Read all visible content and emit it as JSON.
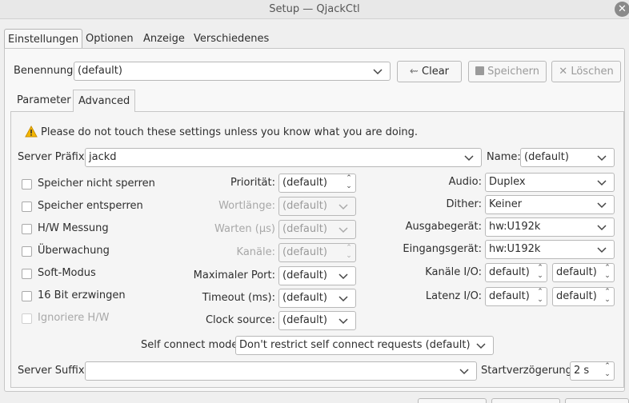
{
  "window": {
    "title": "Setup — QjackCtl"
  },
  "tabs": [
    "Einstellungen",
    "Optionen",
    "Anzeige",
    "Verschiedenes"
  ],
  "preset": {
    "label": "Benennung:",
    "value": "(default)",
    "clear": "Clear",
    "save": "Speichern",
    "delete": "Löschen"
  },
  "subtabs": [
    "Parameter",
    "Advanced"
  ],
  "warning": "Please do not touch these settings unless you know what you are doing.",
  "server": {
    "prefix_label": "Server Präfix:",
    "prefix_value": "jackd",
    "name_label": "Name:",
    "name_value": "(default)"
  },
  "checks": [
    "Speicher nicht sperren",
    "Speicher entsperren",
    "H/W Messung",
    "Überwachung",
    "Soft-Modus",
    "16 Bit erzwingen",
    "Ignoriere H/W"
  ],
  "mid": {
    "priority_label": "Priorität:",
    "priority_value": "(default)",
    "wordlength_label": "Wortlänge:",
    "wordlength_value": "(default)",
    "wait_label": "Warten (µs)",
    "wait_value": "(default)",
    "channels_label": "Kanäle:",
    "channels_value": "(default)",
    "maxport_label": "Maximaler Port:",
    "maxport_value": "(default)",
    "timeout_label": "Timeout (ms):",
    "timeout_value": "(default)",
    "clock_label": "Clock source:",
    "clock_value": "(default)"
  },
  "right": {
    "audio_label": "Audio:",
    "audio_value": "Duplex",
    "dither_label": "Dither:",
    "dither_value": "Keiner",
    "output_label": "Ausgabegerät:",
    "output_value": "hw:U192k",
    "input_label": "Eingangsgerät:",
    "input_value": "hw:U192k",
    "channels_io_label": "Kanäle I/O:",
    "channels_in": "default)",
    "channels_out": "default)",
    "latency_io_label": "Latenz I/O:",
    "latency_in": "default)",
    "latency_out": "default)"
  },
  "selfconnect": {
    "label": "Self connect mode:",
    "value": "Don't restrict self connect requests (default)"
  },
  "suffix": {
    "label": "Server Suffix:",
    "value": ""
  },
  "startdelay": {
    "label": "Startverzögerung:",
    "value": "2 s"
  }
}
